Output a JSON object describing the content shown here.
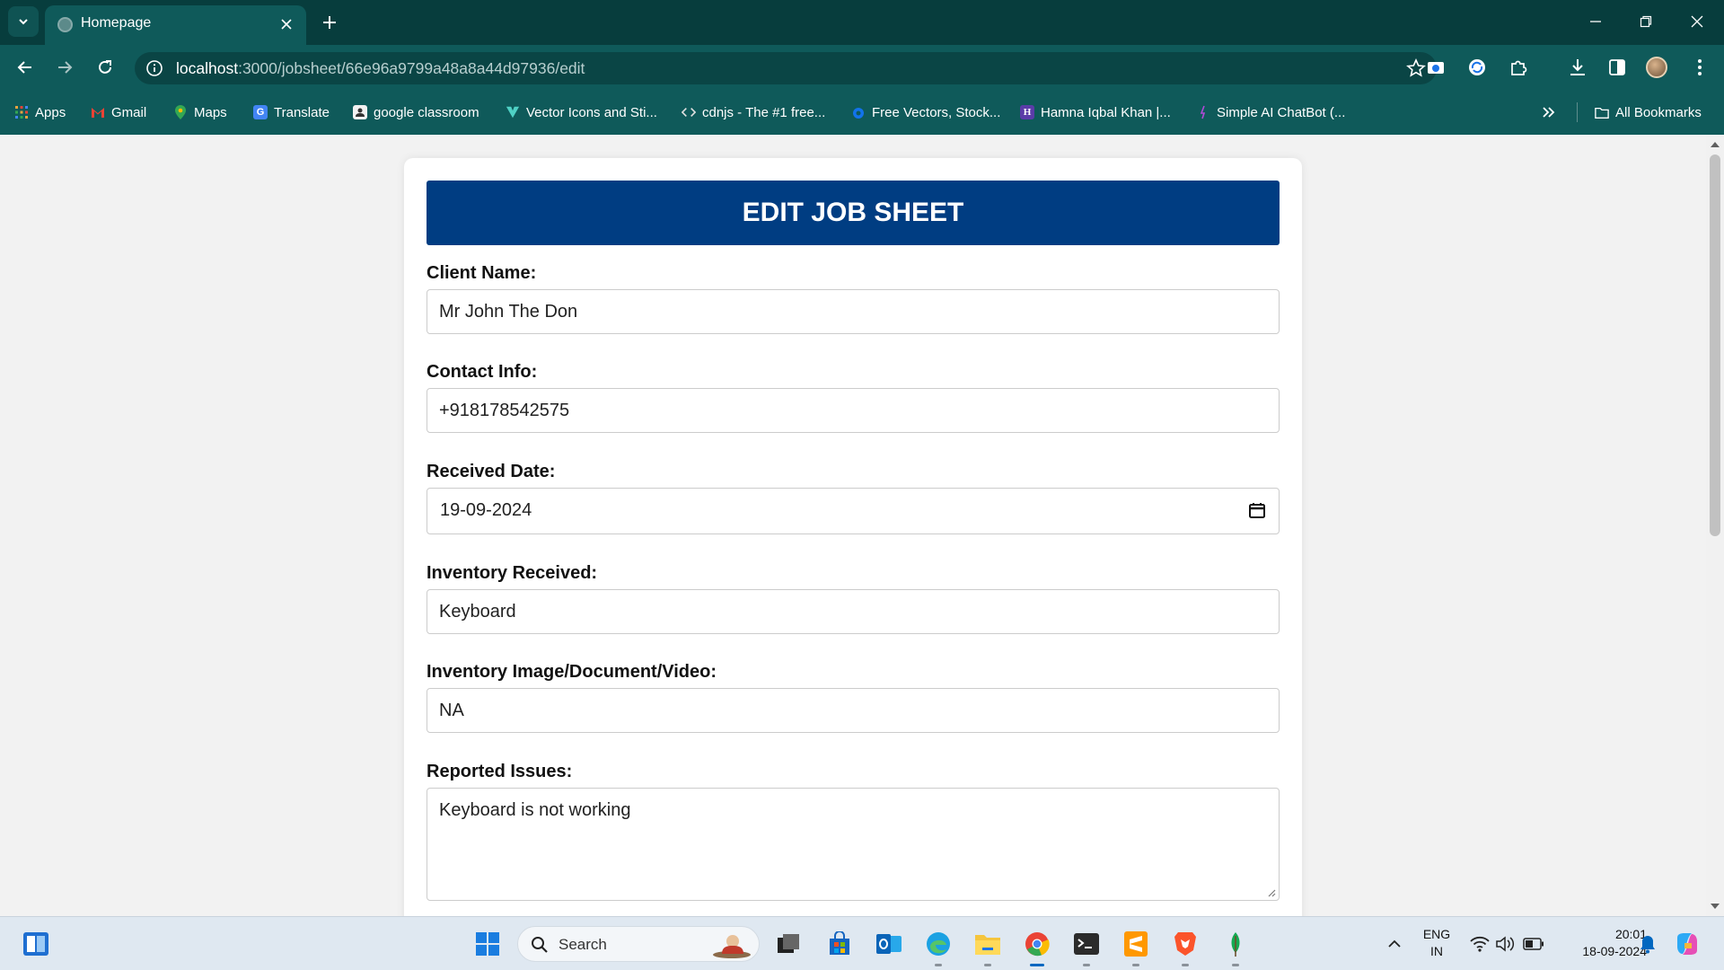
{
  "browser": {
    "tab": {
      "title": "Homepage"
    },
    "address": {
      "host": "localhost",
      "path": ":3000/jobsheet/66e96a9799a48a8a44d97936/edit"
    },
    "bookmarks": [
      {
        "label": "Apps",
        "icon": "apps-grid-icon"
      },
      {
        "label": "Gmail",
        "icon": "gmail-icon"
      },
      {
        "label": "Maps",
        "icon": "maps-icon"
      },
      {
        "label": "Translate",
        "icon": "translate-icon"
      },
      {
        "label": "google classroom",
        "icon": "classroom-icon"
      },
      {
        "label": "Vector Icons and Sti...",
        "icon": "vector-icons-icon"
      },
      {
        "label": "cdnjs - The #1 free...",
        "icon": "code-brackets-icon"
      },
      {
        "label": "Free Vectors, Stock...",
        "icon": "freepik-icon"
      },
      {
        "label": "Hamna Iqbal Khan |...",
        "icon": "hashnode-icon"
      },
      {
        "label": "Simple AI ChatBot (...",
        "icon": "chatbot-icon"
      }
    ],
    "all_bookmarks_label": "All Bookmarks"
  },
  "form": {
    "heading": "EDIT JOB SHEET",
    "fields": [
      {
        "label": "Client Name:",
        "value": "Mr John The Don"
      },
      {
        "label": "Contact Info:",
        "value": "+918178542575"
      },
      {
        "label": "Received Date:",
        "value": "19-09-2024"
      },
      {
        "label": "Inventory Received:",
        "value": "Keyboard"
      },
      {
        "label": "Inventory Image/Document/Video:",
        "value": "NA"
      },
      {
        "label": "Reported Issues:",
        "value": "Keyboard is not working"
      }
    ]
  },
  "taskbar": {
    "search_label": "Search",
    "language": {
      "line1": "ENG",
      "line2": "IN"
    },
    "clock": {
      "time": "20:01",
      "date": "18-09-2024"
    }
  },
  "colors": {
    "tab_strip": "#073d3d",
    "toolbar": "#0f5a5a",
    "banner": "#003d82",
    "page_background": "#f2f2f2"
  }
}
